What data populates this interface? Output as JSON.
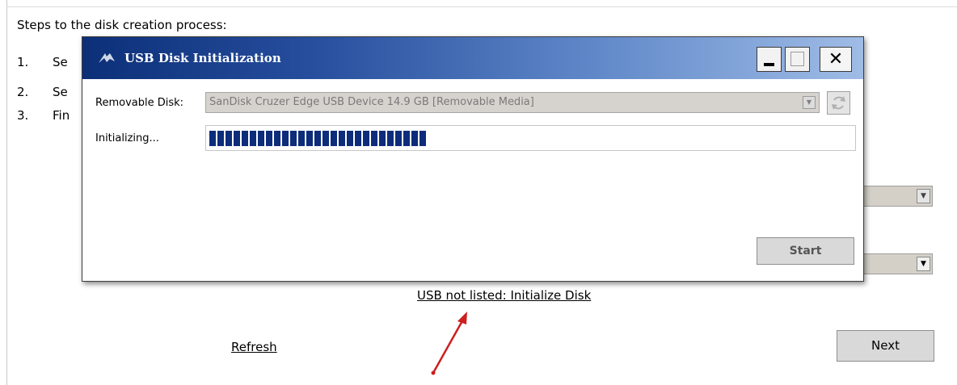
{
  "background": {
    "steps_title": "Steps to the disk creation process:",
    "steps": [
      {
        "num": "1.",
        "text": "Se"
      },
      {
        "num": "2.",
        "text": "Se"
      },
      {
        "num": "3.",
        "text": "Fin"
      }
    ],
    "initialize_link": "USB not listed: Initialize Disk",
    "refresh_link": "Refresh",
    "next_button": "Next"
  },
  "dialog": {
    "title": "USB Disk Initialization",
    "removable_label": "Removable Disk:",
    "removable_value": "SanDisk Cruzer Edge USB Device 14.9 GB [Removable Media]",
    "status_label": "Initializing...",
    "progress_fraction": 0.34,
    "start_button": "Start"
  },
  "colors": {
    "titlebar_dark": "#0c2f78",
    "progress_fill": "#0d2c7a",
    "annotation_arrow": "#cc1f1f"
  },
  "icons": [
    "app-logo-icon",
    "minimize-icon",
    "maximize-icon",
    "close-icon",
    "dropdown-arrow-icon",
    "refresh-icon",
    "annotation-arrow-icon"
  ]
}
